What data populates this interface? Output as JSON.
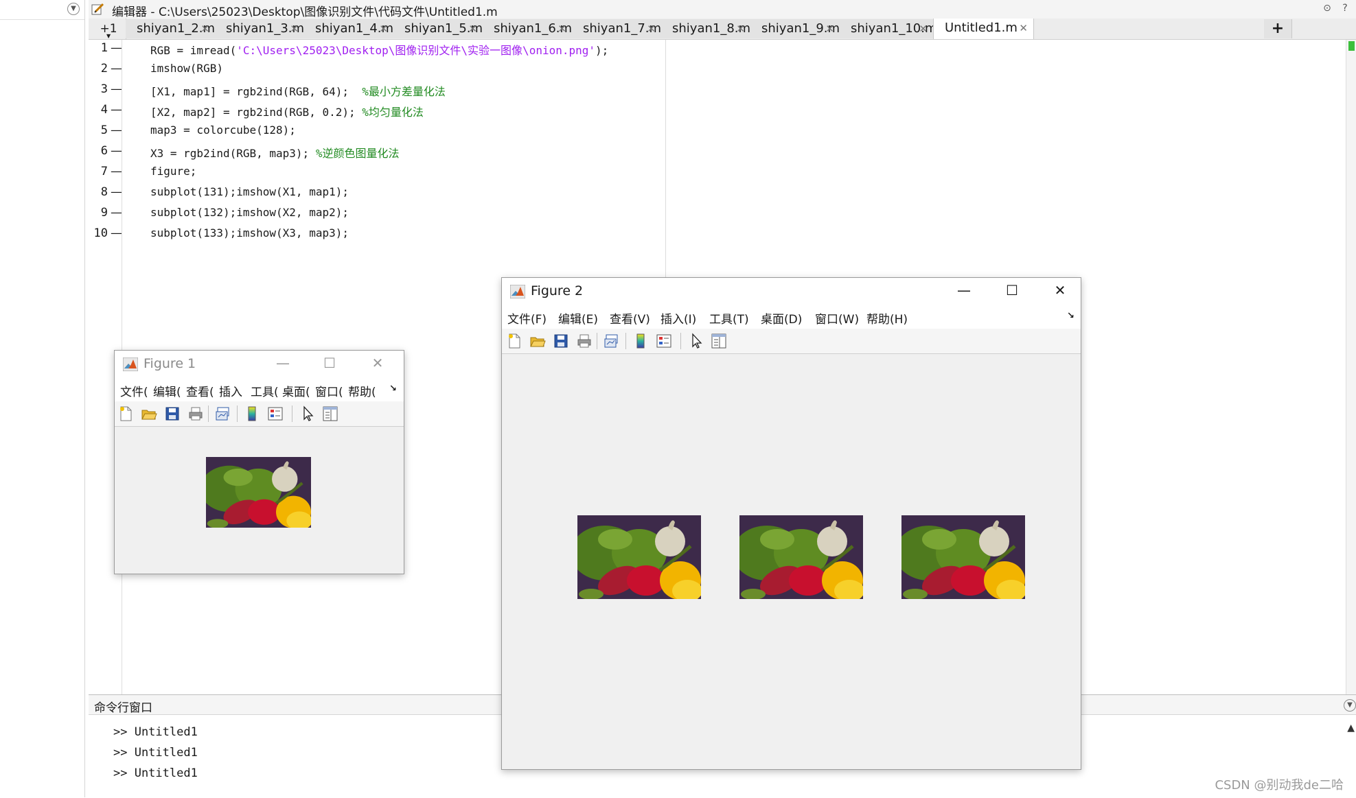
{
  "editor": {
    "title": "编辑器 - C:\\Users\\25023\\Desktop\\图像识别文件\\代码文件\\Untitled1.m",
    "tab_plus1": "+1",
    "tabs": [
      {
        "label": "shiyan1_2.m"
      },
      {
        "label": "shiyan1_3.m"
      },
      {
        "label": "shiyan1_4.m"
      },
      {
        "label": "shiyan1_5.m"
      },
      {
        "label": "shiyan1_6.m"
      },
      {
        "label": "shiyan1_7.m"
      },
      {
        "label": "shiyan1_8.m"
      },
      {
        "label": "shiyan1_9.m"
      },
      {
        "label": "shiyan1_10.m"
      },
      {
        "label": "Untitled1.m",
        "active": true
      }
    ],
    "tab_close_glyph": "✕",
    "tab_add_glyph": "+",
    "line_numbers": [
      "1",
      "2",
      "3",
      "4",
      "5",
      "6",
      "7",
      "8",
      "9",
      "10"
    ],
    "line_dash": "—",
    "code": [
      {
        "a": "RGB = imread(",
        "s": "'C:\\Users\\25023\\Desktop\\图像识别文件\\实验一图像\\onion.png'",
        "b": ");",
        "c": ""
      },
      {
        "a": "imshow(RGB)",
        "s": "",
        "b": "",
        "c": ""
      },
      {
        "a": "[X1, map1] = rgb2ind(RGB, 64);  ",
        "s": "",
        "b": "",
        "c": "%最小方差量化法"
      },
      {
        "a": "[X2, map2] = rgb2ind(RGB, 0.2); ",
        "s": "",
        "b": "",
        "c": "%均匀量化法"
      },
      {
        "a": "map3 = colorcube(128);",
        "s": "",
        "b": "",
        "c": ""
      },
      {
        "a": "X3 = rgb2ind(RGB, map3); ",
        "s": "",
        "b": "",
        "c": "%逆颜色图量化法"
      },
      {
        "a": "figure;",
        "s": "",
        "b": "",
        "c": ""
      },
      {
        "a": "subplot(131);imshow(X1, map1);",
        "s": "",
        "b": "",
        "c": ""
      },
      {
        "a": "subplot(132);imshow(X2, map2);",
        "s": "",
        "b": "",
        "c": ""
      },
      {
        "a": "subplot(133);imshow(X3, map3);",
        "s": "",
        "b": "",
        "c": ""
      }
    ]
  },
  "command_window": {
    "title": "命令行窗口",
    "lines": [
      ">> Untitled1",
      ">> Untitled1",
      ">> Untitled1"
    ]
  },
  "figure1": {
    "title": "Figure 1",
    "menu": [
      "文件(",
      "编辑(",
      "查看(",
      "插入",
      "工具(",
      "桌面(",
      "窗口(",
      "帮助("
    ],
    "more_glyph": "↘",
    "win_min": "—",
    "win_max": "☐",
    "win_close": "✕"
  },
  "figure2": {
    "title": "Figure 2",
    "menu": [
      "文件(F)",
      "编辑(E)",
      "查看(V)",
      "插入(I)",
      "工具(T)",
      "桌面(D)",
      "窗口(W)",
      "帮助(H)"
    ],
    "more_glyph": "↘",
    "win_min": "—",
    "win_max": "☐",
    "win_close": "✕"
  },
  "toolbar_icons": [
    "new-file-icon",
    "open-folder-icon",
    "save-icon",
    "print-icon",
    "link-plot-icon",
    "colorbar-icon",
    "legend-icon",
    "pointer-icon",
    "property-editor-icon"
  ],
  "colors": {
    "string": "#a020f0",
    "comment": "#228b22",
    "window_bg": "#f0f0f0"
  },
  "watermark": "CSDN @别动我de二哈"
}
